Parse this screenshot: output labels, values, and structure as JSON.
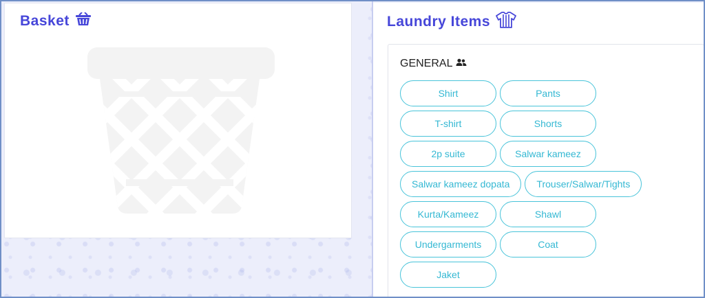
{
  "basket": {
    "title": "Basket",
    "title_icon": "basket-icon",
    "illustration_icon": "wastebasket-icon"
  },
  "laundry": {
    "title": "Laundry Items",
    "title_icon": "shirt-icon",
    "category": {
      "name": "GENERAL",
      "icon": "users-icon"
    },
    "items": [
      {
        "label": "Shirt"
      },
      {
        "label": "Pants"
      },
      {
        "label": "T-shirt"
      },
      {
        "label": "Shorts"
      },
      {
        "label": "2p suite"
      },
      {
        "label": "Salwar kameez"
      },
      {
        "label": "Salwar kameez dopata"
      },
      {
        "label": "Trouser/Salwar/Tights"
      },
      {
        "label": "Kurta/Kameez"
      },
      {
        "label": "Shawl"
      },
      {
        "label": "Undergarments"
      },
      {
        "label": "Coat"
      },
      {
        "label": "Jaket"
      }
    ]
  },
  "colors": {
    "accent": "#4646d9",
    "item_border": "#47c3d9",
    "item_text": "#34b8d3",
    "illustration": "#f3f3f3"
  }
}
